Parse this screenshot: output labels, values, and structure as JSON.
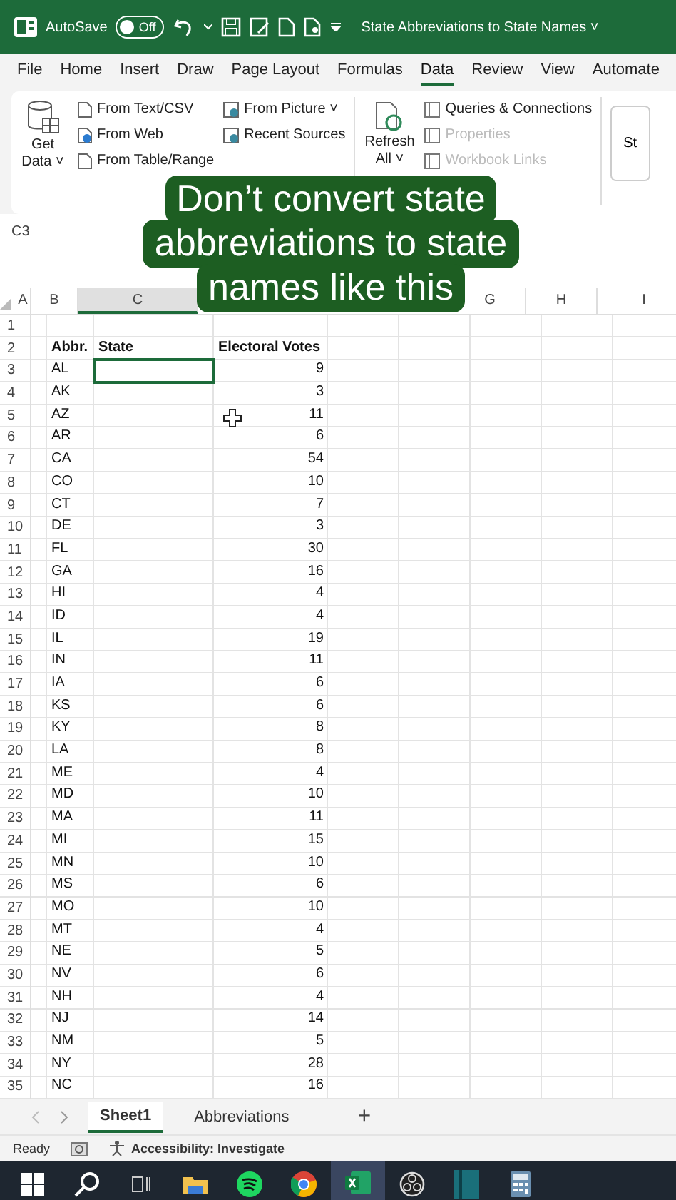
{
  "title_bar": {
    "autosave_label": "AutoSave",
    "autosave_toggle": {
      "label": "Off",
      "on": false
    },
    "document_title": "State Abbreviations to State Names ˅"
  },
  "ribbon_tabs": [
    {
      "label": "File",
      "selected": false
    },
    {
      "label": "Home",
      "selected": false
    },
    {
      "label": "Insert",
      "selected": false
    },
    {
      "label": "Draw",
      "selected": false
    },
    {
      "label": "Page Layout",
      "selected": false
    },
    {
      "label": "Formulas",
      "selected": false
    },
    {
      "label": "Data",
      "selected": true
    },
    {
      "label": "Review",
      "selected": false
    },
    {
      "label": "View",
      "selected": false
    },
    {
      "label": "Automate",
      "selected": false
    }
  ],
  "ribbon": {
    "get_data": {
      "label": "Get Data ˅"
    },
    "column_1": [
      {
        "label": "From Text/CSV",
        "disabled": false
      },
      {
        "label": "From Web",
        "disabled": false
      },
      {
        "label": "From Table/Range",
        "disabled": false
      }
    ],
    "column_2": [
      {
        "label": "From Picture ˅",
        "disabled": false
      },
      {
        "label": "Recent Sources",
        "disabled": false
      }
    ],
    "refresh": {
      "label": "Refresh All ˅"
    },
    "column_3": [
      {
        "label": "Queries & Connections",
        "disabled": false
      },
      {
        "label": "Properties",
        "disabled": true
      },
      {
        "label": "Workbook Links",
        "disabled": true
      }
    ],
    "cut_button": {
      "label": "St"
    }
  },
  "name_box": {
    "value": "C3"
  },
  "caption": "Don’t convert state abbreviations to state names like this",
  "column_headers": [
    {
      "label": "A",
      "selected": false
    },
    {
      "label": "B",
      "selected": false
    },
    {
      "label": "C",
      "selected": true
    },
    {
      "label": "G",
      "selected": false
    },
    {
      "label": "H",
      "selected": false
    },
    {
      "label": "I",
      "selected": false
    }
  ],
  "table": {
    "header_row": "2",
    "headers": [
      "Abbr.",
      "State",
      "Electoral Votes"
    ],
    "rows": [
      {
        "n": "3",
        "abbr": "AL",
        "state_selected": true,
        "votes": "9"
      },
      {
        "n": "4",
        "abbr": "AK",
        "state_selected": false,
        "votes": "3"
      },
      {
        "n": "5",
        "abbr": "AZ",
        "state_selected": false,
        "votes": "11"
      },
      {
        "n": "6",
        "abbr": "AR",
        "state_selected": false,
        "votes": "6"
      },
      {
        "n": "7",
        "abbr": "CA",
        "state_selected": false,
        "votes": "54"
      },
      {
        "n": "8",
        "abbr": "CO",
        "state_selected": false,
        "votes": "10"
      },
      {
        "n": "9",
        "abbr": "CT",
        "state_selected": false,
        "votes": "7"
      },
      {
        "n": "10",
        "abbr": "DE",
        "state_selected": false,
        "votes": "3"
      },
      {
        "n": "11",
        "abbr": "FL",
        "state_selected": false,
        "votes": "30"
      },
      {
        "n": "12",
        "abbr": "GA",
        "state_selected": false,
        "votes": "16"
      },
      {
        "n": "13",
        "abbr": "HI",
        "state_selected": false,
        "votes": "4"
      },
      {
        "n": "14",
        "abbr": "ID",
        "state_selected": false,
        "votes": "4"
      },
      {
        "n": "15",
        "abbr": "IL",
        "state_selected": false,
        "votes": "19"
      },
      {
        "n": "16",
        "abbr": "IN",
        "state_selected": false,
        "votes": "11"
      },
      {
        "n": "17",
        "abbr": "IA",
        "state_selected": false,
        "votes": "6"
      },
      {
        "n": "18",
        "abbr": "KS",
        "state_selected": false,
        "votes": "6"
      },
      {
        "n": "19",
        "abbr": "KY",
        "state_selected": false,
        "votes": "8"
      },
      {
        "n": "20",
        "abbr": "LA",
        "state_selected": false,
        "votes": "8"
      },
      {
        "n": "21",
        "abbr": "ME",
        "state_selected": false,
        "votes": "4"
      },
      {
        "n": "22",
        "abbr": "MD",
        "state_selected": false,
        "votes": "10"
      },
      {
        "n": "23",
        "abbr": "MA",
        "state_selected": false,
        "votes": "11"
      },
      {
        "n": "24",
        "abbr": "MI",
        "state_selected": false,
        "votes": "15"
      },
      {
        "n": "25",
        "abbr": "MN",
        "state_selected": false,
        "votes": "10"
      },
      {
        "n": "26",
        "abbr": "MS",
        "state_selected": false,
        "votes": "6"
      },
      {
        "n": "27",
        "abbr": "MO",
        "state_selected": false,
        "votes": "10"
      },
      {
        "n": "28",
        "abbr": "MT",
        "state_selected": false,
        "votes": "4"
      },
      {
        "n": "29",
        "abbr": "NE",
        "state_selected": false,
        "votes": "5"
      },
      {
        "n": "30",
        "abbr": "NV",
        "state_selected": false,
        "votes": "6"
      },
      {
        "n": "31",
        "abbr": "NH",
        "state_selected": false,
        "votes": "4"
      },
      {
        "n": "32",
        "abbr": "NJ",
        "state_selected": false,
        "votes": "14"
      },
      {
        "n": "33",
        "abbr": "NM",
        "state_selected": false,
        "votes": "5"
      },
      {
        "n": "34",
        "abbr": "NY",
        "state_selected": false,
        "votes": "28"
      },
      {
        "n": "35",
        "abbr": "NC",
        "state_selected": false,
        "votes": "16"
      }
    ],
    "first_row": "1"
  },
  "sheet_tabs": [
    {
      "label": "Sheet1",
      "selected": true
    },
    {
      "label": "Abbreviations",
      "selected": false
    }
  ],
  "add_sheet": "+",
  "status_bar": {
    "ready": "Ready",
    "accessibility": "Accessibility: Investigate"
  },
  "taskbar": [
    {
      "kind": "start",
      "active": false
    },
    {
      "kind": "search",
      "active": false
    },
    {
      "kind": "taskview",
      "active": false
    },
    {
      "kind": "folder",
      "active": false
    },
    {
      "kind": "music",
      "active": false
    },
    {
      "kind": "browser",
      "active": false
    },
    {
      "kind": "spreadsheet",
      "active": true
    },
    {
      "kind": "aperture",
      "active": false
    },
    {
      "kind": "book",
      "active": false
    },
    {
      "kind": "calculator",
      "active": false
    }
  ]
}
